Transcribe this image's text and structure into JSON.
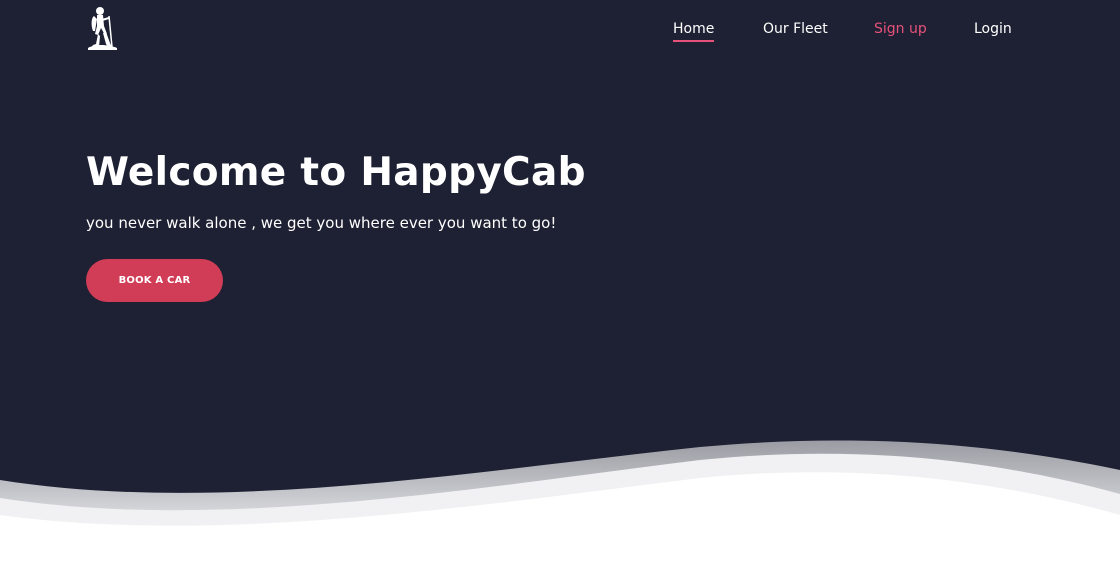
{
  "nav": {
    "items": [
      {
        "label": "Home",
        "active": true
      },
      {
        "label": "Our Fleet",
        "active": false
      },
      {
        "label": "Sign up",
        "active": false
      },
      {
        "label": "Login",
        "active": false
      }
    ]
  },
  "hero": {
    "title": "Welcome to HappyCab",
    "subtitle": "you never walk alone , we get you where ever you want to go!",
    "cta_label": "BOOK A CAR"
  },
  "logo": {
    "icon": "hiker-icon"
  },
  "colors": {
    "hero_bg": "#1e2133",
    "accent_pink": "#e8517a",
    "cta_bg": "#d13d57",
    "text": "#ffffff",
    "page_bg": "#ffffff"
  }
}
